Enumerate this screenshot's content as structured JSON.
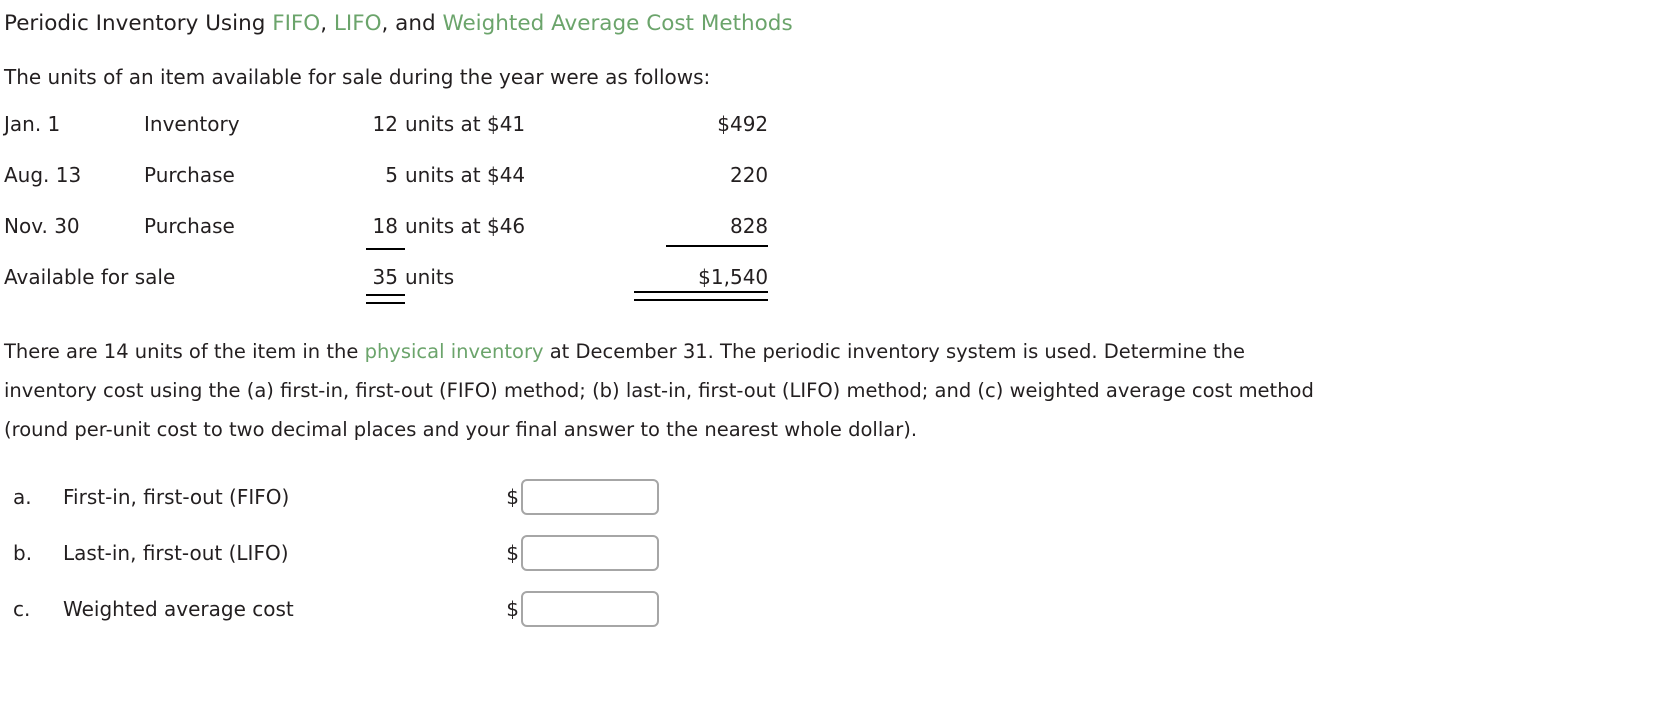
{
  "title": {
    "part1": "Periodic Inventory Using ",
    "fifo": "FIFO",
    "sep1": ", ",
    "lifo": "LIFO",
    "sep2": ", and ",
    "wac": "Weighted Average Cost Methods"
  },
  "intro": "The units of an item available for sale during the year were as follows:",
  "table": {
    "rows": [
      {
        "date": "Jan. 1",
        "desc": "Inventory",
        "qty": "12",
        "unit": "units at $41",
        "amount": "$492"
      },
      {
        "date": "Aug. 13",
        "desc": "Purchase",
        "qty": "5",
        "unit": "units at $44",
        "amount": "220"
      },
      {
        "date": "Nov. 30",
        "desc": "Purchase",
        "qty": "18",
        "unit": "units at $46",
        "amount": "828"
      }
    ],
    "total": {
      "label": "Available for sale",
      "qty": "35",
      "unit": "units",
      "amount": "$1,540"
    }
  },
  "paragraph": {
    "line1_a": "There are 14 units of the item in the ",
    "line1_green": "physical inventory",
    "line1_b": " at December 31. The periodic inventory system is used. Determine the",
    "line2": "inventory cost using the (a) first-in, first-out (FIFO) method; (b) last-in, first-out (LIFO) method; and (c) weighted average cost method",
    "line3": "(round per-unit cost to two decimal places and your final answer to the nearest whole dollar)."
  },
  "answers": {
    "currency_symbol": "$",
    "rows": [
      {
        "letter": "a.",
        "label": "First-in, first-out (FIFO)",
        "value": "",
        "placeholder": ""
      },
      {
        "letter": "b.",
        "label": "Last-in, first-out (LIFO)",
        "value": "",
        "placeholder": ""
      },
      {
        "letter": "c.",
        "label": "Weighted average cost",
        "value": "",
        "placeholder": ""
      }
    ]
  },
  "colors": {
    "accent_green": "#6ba46b",
    "text": "#231f20",
    "input_border": "#a6a6a6"
  }
}
